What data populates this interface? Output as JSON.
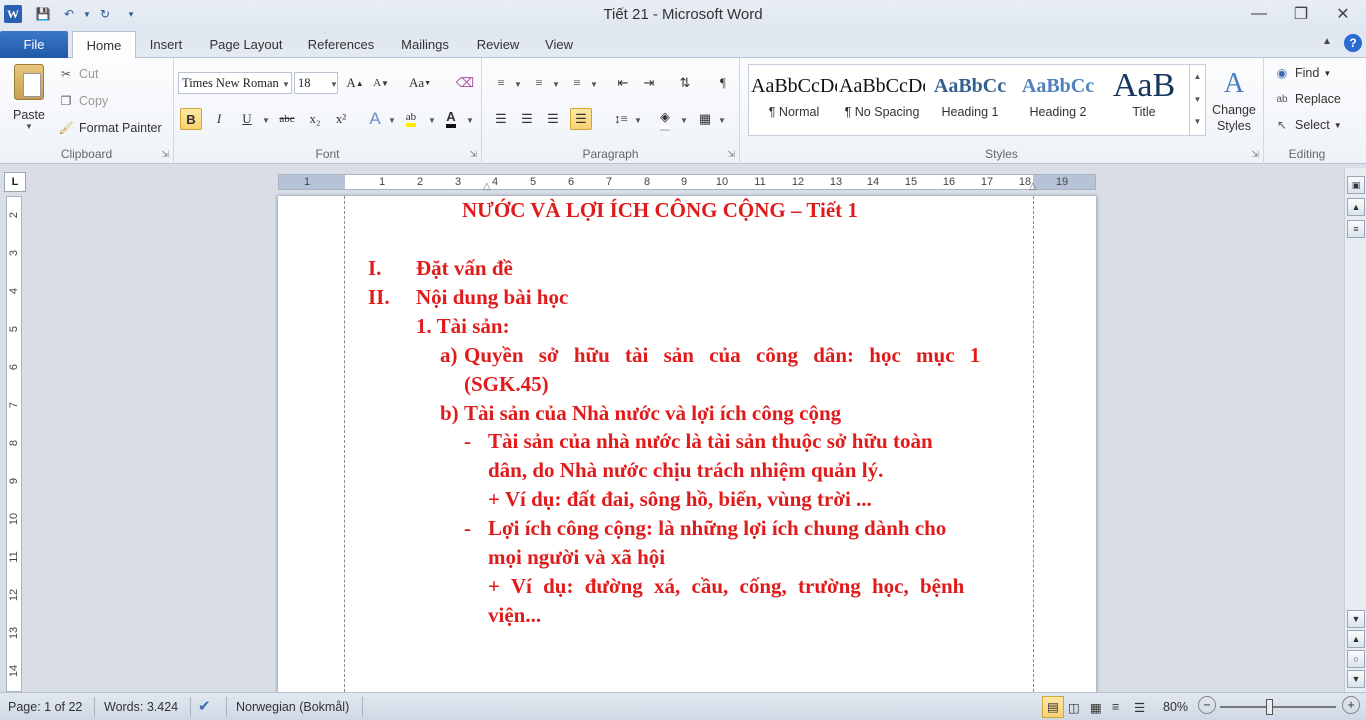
{
  "window": {
    "title": "Tiết 21 - Microsoft Word"
  },
  "quick_access": {
    "app_icon": "W"
  },
  "tabs": [
    "File",
    "Home",
    "Insert",
    "Page Layout",
    "References",
    "Mailings",
    "Review",
    "View"
  ],
  "ribbon": {
    "clipboard": {
      "paste": "Paste",
      "cut": "Cut",
      "copy": "Copy",
      "format_painter": "Format Painter",
      "label": "Clipboard"
    },
    "font": {
      "name": "Times New Roman",
      "size": "18",
      "label": "Font",
      "bold": "B",
      "italic": "I",
      "underline": "U",
      "strike": "abc",
      "subscript": "x₂",
      "superscript": "x²",
      "grow": "A",
      "shrink": "A",
      "change_case": "Aa"
    },
    "paragraph": {
      "label": "Paragraph"
    },
    "styles": {
      "items": [
        {
          "preview": "AaBbCcDd",
          "name": "¶ Normal"
        },
        {
          "preview": "AaBbCcDd",
          "name": "¶ No Spacing"
        },
        {
          "preview": "AaBbCc",
          "name": "Heading 1"
        },
        {
          "preview": "AaBbCc",
          "name": "Heading 2"
        },
        {
          "preview": "AaB",
          "name": "Title"
        }
      ],
      "change_styles": "Change Styles",
      "label": "Styles"
    },
    "editing": {
      "find": "Find",
      "replace": "Replace",
      "select": "Select",
      "label": "Editing"
    }
  },
  "ruler": {
    "h_numbers": [
      "1",
      "1",
      "2",
      "3",
      "4",
      "5",
      "6",
      "7",
      "8",
      "9",
      "10",
      "11",
      "12",
      "13",
      "14",
      "15",
      "16",
      "17",
      "18",
      "19"
    ],
    "v_numbers": [
      "2",
      "3",
      "4",
      "5",
      "6",
      "7",
      "8",
      "9",
      "10",
      "11",
      "12",
      "13",
      "14"
    ]
  },
  "document": {
    "heading": "NƯỚC VÀ LỢI ÍCH CÔNG CỘNG – Tiết 1",
    "lines": [
      {
        "marker": "I.",
        "text": "Đặt vấn đề"
      },
      {
        "marker": "II.",
        "text": "Nội dung bài học"
      },
      {
        "marker": "",
        "text": "1. Tài sản:"
      },
      {
        "marker": "a)",
        "text": "Quyền sở hữu tài sản của công dân: học mục 1"
      },
      {
        "marker": "",
        "text": "(SGK.45)"
      },
      {
        "marker": "b)",
        "text": "Tài sản của Nhà nước và lợi ích công cộng"
      },
      {
        "marker": "-",
        "text": "Tài sản của nhà nước là tài sản thuộc sở hữu toàn"
      },
      {
        "marker": "",
        "text": "dân, do Nhà nước chịu trách nhiệm quản lý."
      },
      {
        "marker": "",
        "text": "+ Ví dụ: đất đai, sông hồ, biển, vùng trời ..."
      },
      {
        "marker": "-",
        "text": "Lợi ích công cộng: là những lợi ích chung dành cho"
      },
      {
        "marker": "",
        "text": "mọi người và xã hội"
      },
      {
        "marker": "",
        "text": "+ Ví dụ: đường xá, cầu, cống, trường học, bệnh"
      },
      {
        "marker": "",
        "text": "viện..."
      }
    ],
    "text_color": "#e01b1b"
  },
  "statusbar": {
    "page": "Page: 1 of 22",
    "words": "Words: 3.424",
    "language": "Norwegian (Bokmål)",
    "zoom": "80%"
  }
}
